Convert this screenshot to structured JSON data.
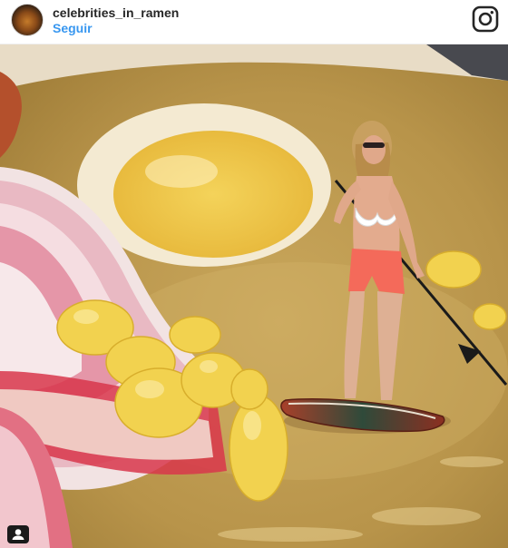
{
  "post": {
    "username": "celebrities_in_ramen",
    "follow_label": "Seguir"
  },
  "icons": {
    "avatar": "profile-avatar",
    "app": "instagram-icon",
    "badge": "user-tag-icon"
  },
  "colors": {
    "follow_link": "#3897f0",
    "username": "#262626"
  }
}
